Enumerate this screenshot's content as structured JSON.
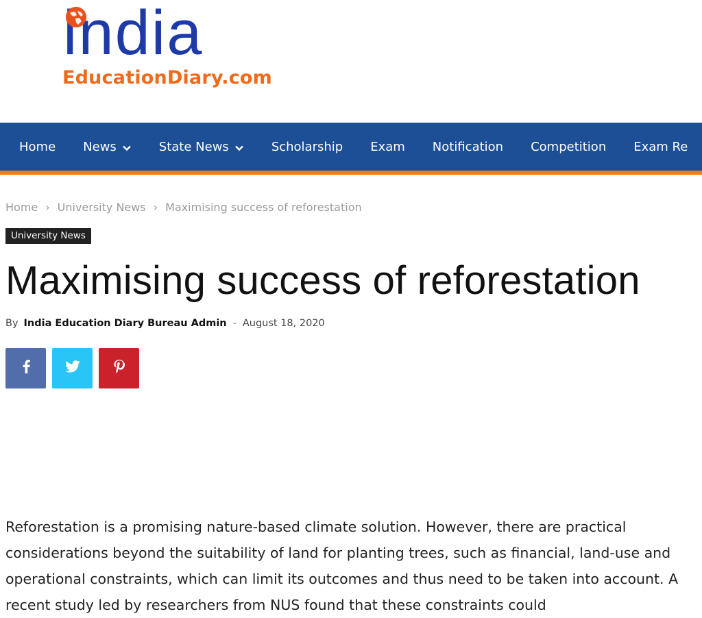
{
  "logo": {
    "word": "india",
    "domain": "EducationDiary.com"
  },
  "nav": {
    "items": [
      {
        "label": "Home",
        "dropdown": false
      },
      {
        "label": "News",
        "dropdown": true
      },
      {
        "label": "State News",
        "dropdown": true
      },
      {
        "label": "Scholarship",
        "dropdown": false
      },
      {
        "label": "Exam",
        "dropdown": false
      },
      {
        "label": "Notification",
        "dropdown": false
      },
      {
        "label": "Competition",
        "dropdown": false
      },
      {
        "label": "Exam Re",
        "dropdown": false
      }
    ]
  },
  "breadcrumb": {
    "home": "Home",
    "category": "University News",
    "current": "Maximising success of reforestation",
    "separator": "›"
  },
  "article": {
    "category": "University News",
    "title": "Maximising success of reforestation",
    "by": "By",
    "author": "India Education Diary Bureau Admin",
    "dash": "-",
    "date": "August 18, 2020",
    "body": "Reforestation is a promising nature-based climate solution. However, there are practical considerations beyond the suitability of land for planting trees, such as financial, land-use and operational constraints, which can limit its outcomes and thus need to be taken into account. A recent study led by researchers from NUS found that these constraints could"
  },
  "share": {
    "facebook_icon": "facebook-icon",
    "twitter_icon": "twitter-icon",
    "pinterest_icon": "pinterest-icon"
  },
  "colors": {
    "nav_bg": "#1d4f97",
    "nav_border": "#ee7f1b",
    "facebook": "#516eab",
    "twitter": "#29c5f6",
    "pinterest": "#ca212a",
    "logo_blue": "#1d3aa8",
    "logo_orange": "#ef6a1a"
  }
}
